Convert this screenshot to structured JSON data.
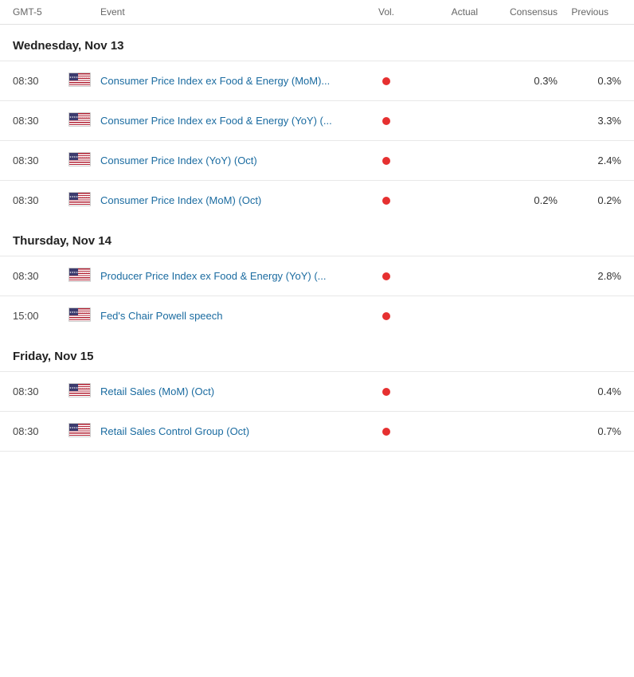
{
  "header": {
    "time_label": "GMT-5",
    "event_label": "Event",
    "vol_label": "Vol.",
    "actual_label": "Actual",
    "consensus_label": "Consensus",
    "previous_label": "Previous"
  },
  "sections": [
    {
      "id": "wednesday",
      "title": "Wednesday, Nov 13",
      "events": [
        {
          "id": "ev1",
          "time": "08:30",
          "country": "US",
          "name": "Consumer Price Index ex Food & Energy (MoM)...",
          "has_dot": true,
          "actual": "",
          "consensus": "0.3%",
          "previous": "0.3%"
        },
        {
          "id": "ev2",
          "time": "08:30",
          "country": "US",
          "name": "Consumer Price Index ex Food & Energy (YoY) (...",
          "has_dot": true,
          "actual": "",
          "consensus": "",
          "previous": "3.3%"
        },
        {
          "id": "ev3",
          "time": "08:30",
          "country": "US",
          "name": "Consumer Price Index (YoY) (Oct)",
          "has_dot": true,
          "actual": "",
          "consensus": "",
          "previous": "2.4%"
        },
        {
          "id": "ev4",
          "time": "08:30",
          "country": "US",
          "name": "Consumer Price Index (MoM) (Oct)",
          "has_dot": true,
          "actual": "",
          "consensus": "0.2%",
          "previous": "0.2%"
        }
      ]
    },
    {
      "id": "thursday",
      "title": "Thursday, Nov 14",
      "events": [
        {
          "id": "ev5",
          "time": "08:30",
          "country": "US",
          "name": "Producer Price Index ex Food & Energy (YoY) (...",
          "has_dot": true,
          "actual": "",
          "consensus": "",
          "previous": "2.8%"
        },
        {
          "id": "ev6",
          "time": "15:00",
          "country": "US",
          "name": "Fed's Chair Powell speech",
          "has_dot": true,
          "actual": "",
          "consensus": "",
          "previous": ""
        }
      ]
    },
    {
      "id": "friday",
      "title": "Friday, Nov 15",
      "events": [
        {
          "id": "ev7",
          "time": "08:30",
          "country": "US",
          "name": "Retail Sales (MoM) (Oct)",
          "has_dot": true,
          "actual": "",
          "consensus": "",
          "previous": "0.4%"
        },
        {
          "id": "ev8",
          "time": "08:30",
          "country": "US",
          "name": "Retail Sales Control Group (Oct)",
          "has_dot": true,
          "actual": "",
          "consensus": "",
          "previous": "0.7%"
        }
      ]
    }
  ]
}
